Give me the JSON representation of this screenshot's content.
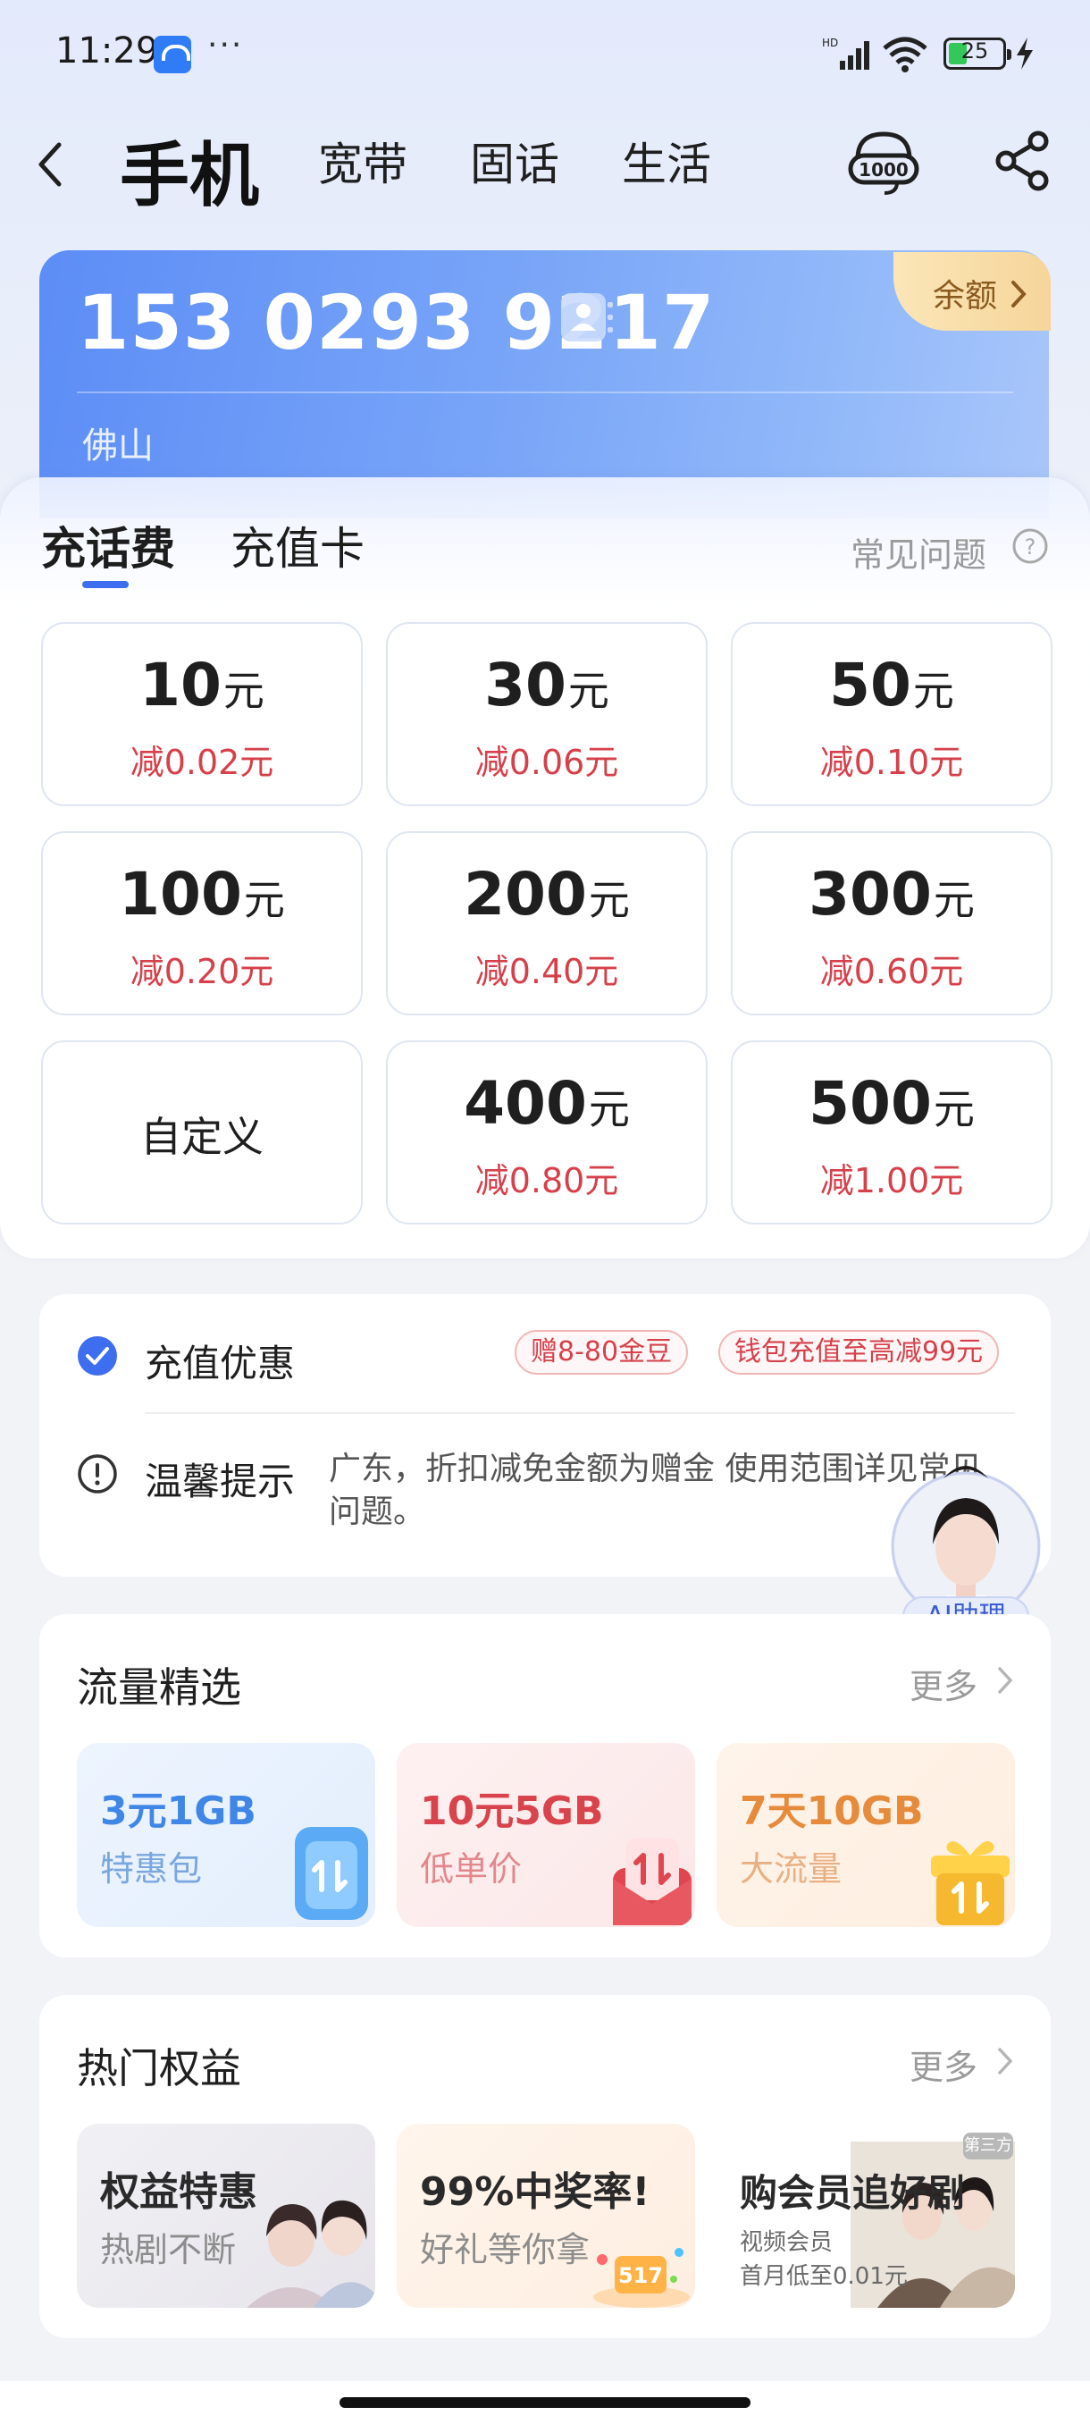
{
  "status_bar": {
    "time": "11:29",
    "dots": "···",
    "battery": "25"
  },
  "nav": {
    "tabs": [
      {
        "label": "手机",
        "active": true
      },
      {
        "label": "宽带",
        "active": false
      },
      {
        "label": "固话",
        "active": false
      },
      {
        "label": "生活",
        "active": false
      }
    ]
  },
  "account_card": {
    "number": "153 0293 9217",
    "city": "佛山",
    "balance_label": "余额"
  },
  "recharge": {
    "tabs": [
      "充话费",
      "充值卡"
    ],
    "faq_label": "常见问题",
    "options": [
      {
        "amount": "10",
        "unit": "元",
        "discount": "减0.02元"
      },
      {
        "amount": "30",
        "unit": "元",
        "discount": "减0.06元"
      },
      {
        "amount": "50",
        "unit": "元",
        "discount": "减0.10元"
      },
      {
        "amount": "100",
        "unit": "元",
        "discount": "减0.20元"
      },
      {
        "amount": "200",
        "unit": "元",
        "discount": "减0.40元"
      },
      {
        "amount": "300",
        "unit": "元",
        "discount": "减0.60元"
      },
      {
        "custom_label": "自定义"
      },
      {
        "amount": "400",
        "unit": "元",
        "discount": "减0.80元"
      },
      {
        "amount": "500",
        "unit": "元",
        "discount": "减1.00元"
      }
    ]
  },
  "promotions": {
    "title": "充值优惠",
    "badges": [
      "赠8-80金豆",
      "钱包充值至高减99元"
    ],
    "tip_label": "温馨提示",
    "tip_text": "广东，折扣减免金额为赠金 使用范围详见常见问题。"
  },
  "ai_assistant": {
    "label": "AI助理"
  },
  "data_picks": {
    "title": "流量精选",
    "more_label": "更多",
    "items": [
      {
        "title": "3元1GB",
        "subtitle": "特惠包",
        "color": "#3f86e6"
      },
      {
        "title": "10元5GB",
        "subtitle": "低单价",
        "color": "#d9434c"
      },
      {
        "title": "7天10GB",
        "subtitle": "大流量",
        "color": "#e68a3c"
      }
    ]
  },
  "hot_perks": {
    "title": "热门权益",
    "more_label": "更多",
    "items": [
      {
        "title": "权益特惠",
        "subtitle": "热剧不断"
      },
      {
        "title": "99%中奖率!",
        "subtitle": "好礼等你拿"
      },
      {
        "title": "购会员追好剧",
        "subtitle": "视频会员",
        "subtitle2": "首月低至0.01元",
        "tag": "第三方"
      }
    ]
  }
}
